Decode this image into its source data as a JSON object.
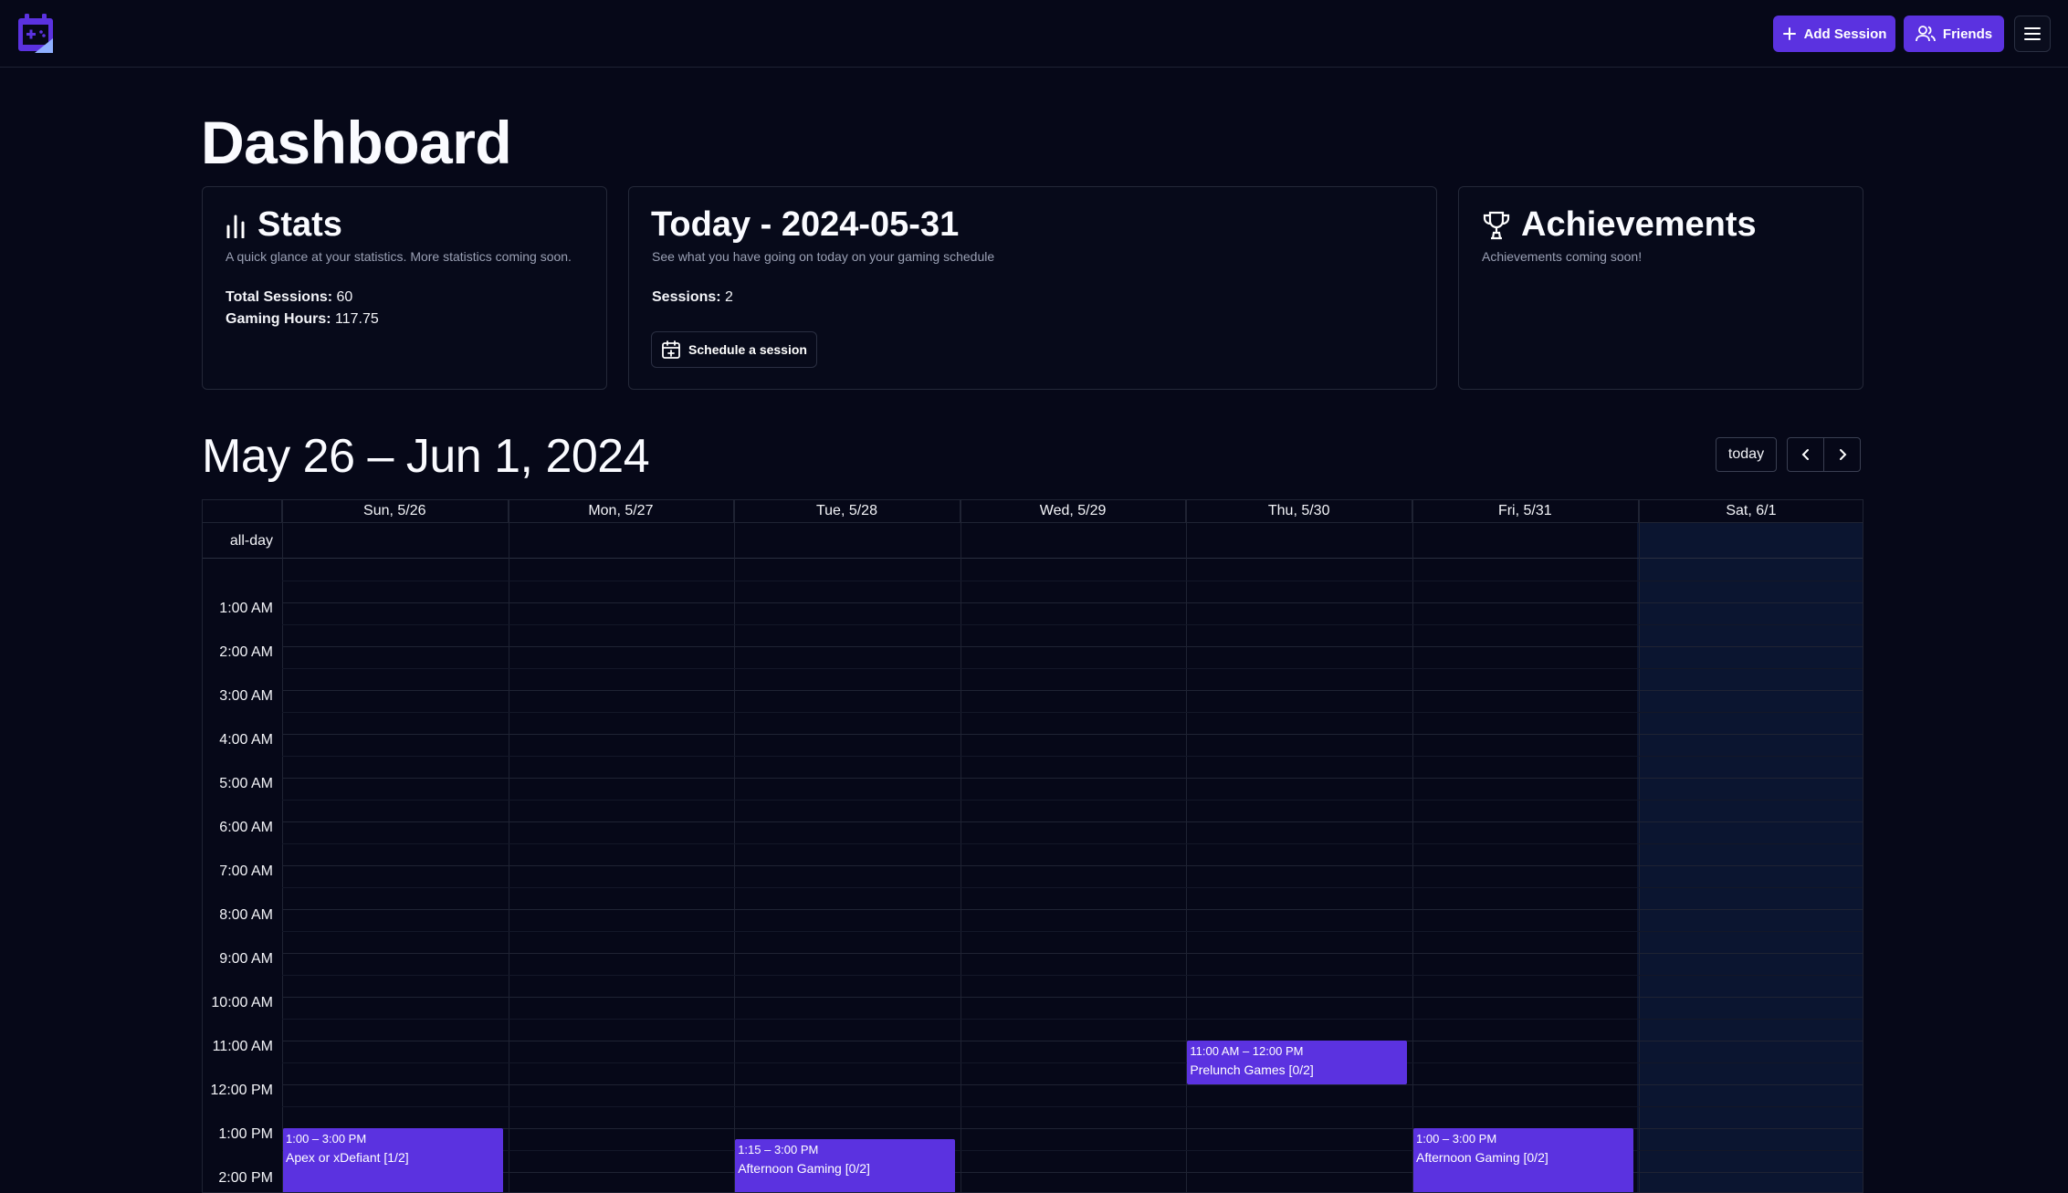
{
  "nav": {
    "add_session_label": "Add Session",
    "friends_label": "Friends"
  },
  "page": {
    "title": "Dashboard"
  },
  "cards": {
    "stats": {
      "title": "Stats",
      "subtitle": "A quick glance at your statistics. More statistics coming soon.",
      "total_sessions_label": "Total Sessions:",
      "total_sessions_value": "60",
      "gaming_hours_label": "Gaming Hours:",
      "gaming_hours_value": "117.75"
    },
    "today": {
      "title": "Today - 2024-05-31",
      "subtitle": "See what you have going on today on your gaming schedule",
      "sessions_label": "Sessions:",
      "sessions_value": "2",
      "schedule_button_label": "Schedule a session"
    },
    "achievements": {
      "title": "Achievements",
      "subtitle": "Achievements coming soon!"
    }
  },
  "calendar": {
    "range_title": "May 26 – Jun 1, 2024",
    "today_label": "today",
    "allday_label": "all-day",
    "days": [
      "Sun, 5/26",
      "Mon, 5/27",
      "Tue, 5/28",
      "Wed, 5/29",
      "Thu, 5/30",
      "Fri, 5/31",
      "Sat, 6/1"
    ],
    "hours": [
      "1:00 AM",
      "2:00 AM",
      "3:00 AM",
      "4:00 AM",
      "5:00 AM",
      "6:00 AM",
      "7:00 AM",
      "8:00 AM",
      "9:00 AM",
      "10:00 AM",
      "11:00 AM",
      "12:00 PM",
      "1:00 PM",
      "2:00 PM"
    ],
    "events": [
      {
        "day": 4,
        "time": "11:00 AM – 12:00 PM",
        "title": "Prelunch Games [0/2]",
        "start": 11.0,
        "end": 12.0
      },
      {
        "day": 0,
        "time": "1:00 – 3:00 PM",
        "title": "Apex or xDefiant [1/2]",
        "start": 13.0,
        "end": 15.0
      },
      {
        "day": 2,
        "time": "1:15 – 3:00 PM",
        "title": "Afternoon Gaming [0/2]",
        "start": 13.25,
        "end": 15.0
      },
      {
        "day": 5,
        "time": "1:00 – 3:00 PM",
        "title": "Afternoon Gaming [0/2]",
        "start": 13.0,
        "end": 15.0
      }
    ]
  },
  "colors": {
    "background": "#060818",
    "accent": "#5b32e0",
    "today_column": "#0b1530"
  }
}
